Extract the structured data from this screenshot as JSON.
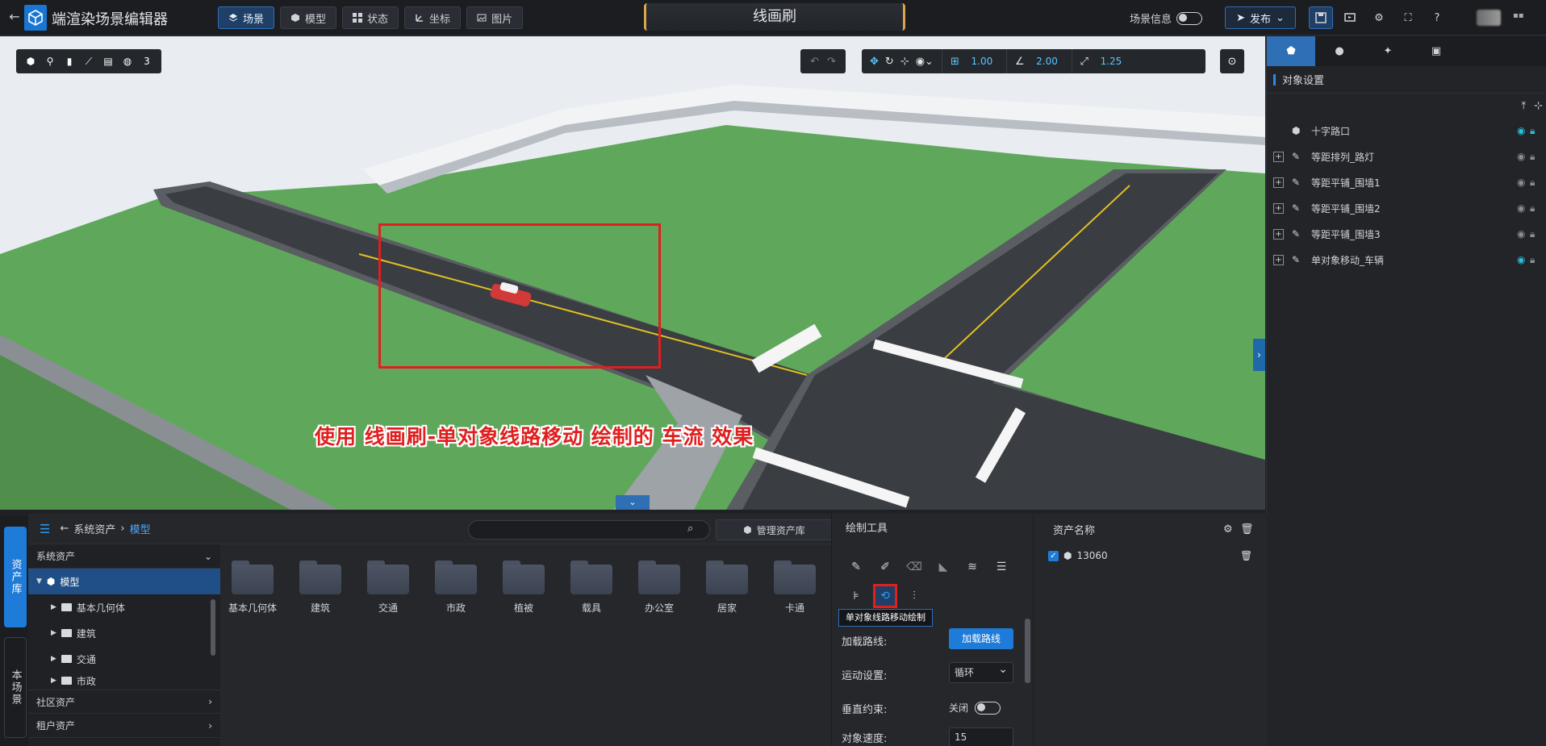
{
  "app": {
    "title": "端渲染场景编辑器"
  },
  "modes": [
    {
      "label": "场景",
      "icon": "layers-icon",
      "active": true
    },
    {
      "label": "模型",
      "icon": "cube-icon",
      "active": false
    },
    {
      "label": "状态",
      "icon": "grid-icon",
      "active": false
    },
    {
      "label": "坐标",
      "icon": "axis-icon",
      "active": false
    },
    {
      "label": "图片",
      "icon": "image-icon",
      "active": false
    }
  ],
  "header": {
    "tool_name": "线画刷",
    "scene_info_label": "场景信息",
    "publish_label": "发布"
  },
  "viewport": {
    "caption": "使用 线画刷-单对象线路移动 绘制的 车流 效果",
    "grid_value": "1.00",
    "angle_value": "2.00",
    "scale_value": "1.25"
  },
  "right_panel": {
    "section_title": "对象设置",
    "items": [
      {
        "label": "十字路口",
        "expandable": false,
        "visible": true
      },
      {
        "label": "等距排列_路灯",
        "expandable": true,
        "visible": false
      },
      {
        "label": "等距平铺_围墙1",
        "expandable": true,
        "visible": false
      },
      {
        "label": "等距平铺_围墙2",
        "expandable": true,
        "visible": false
      },
      {
        "label": "等距平铺_围墙3",
        "expandable": true,
        "visible": false
      },
      {
        "label": "单对象移动_车辆",
        "expandable": true,
        "visible": true
      }
    ]
  },
  "side_tabs": {
    "asset_library": "资产库",
    "this_scene": "本场景"
  },
  "assets": {
    "breadcrumb_root": "系统资产",
    "breadcrumb_current": "模型",
    "search_placeholder": "",
    "manage_label": "管理资产库",
    "tree": {
      "system": "系统资产",
      "model": "模型",
      "children": [
        "基本几何体",
        "建筑",
        "交通",
        "市政"
      ],
      "community": "社区资产",
      "tenant": "租户资产"
    },
    "folders": [
      "基本几何体",
      "建筑",
      "交通",
      "市政",
      "植被",
      "载具",
      "办公室",
      "居家",
      "卡通"
    ]
  },
  "draw_tools": {
    "title": "绘制工具",
    "tooltip": "单对象线路移动绘制",
    "load_route_label": "加载路线:",
    "load_route_button": "加载路线",
    "motion_label": "运动设置:",
    "motion_value": "循环",
    "vertical_label": "垂直约束:",
    "vertical_value": "关闭",
    "speed_label": "对象速度:",
    "speed_value": "15"
  },
  "asset_name": {
    "title": "资产名称",
    "items": [
      "13060"
    ]
  }
}
